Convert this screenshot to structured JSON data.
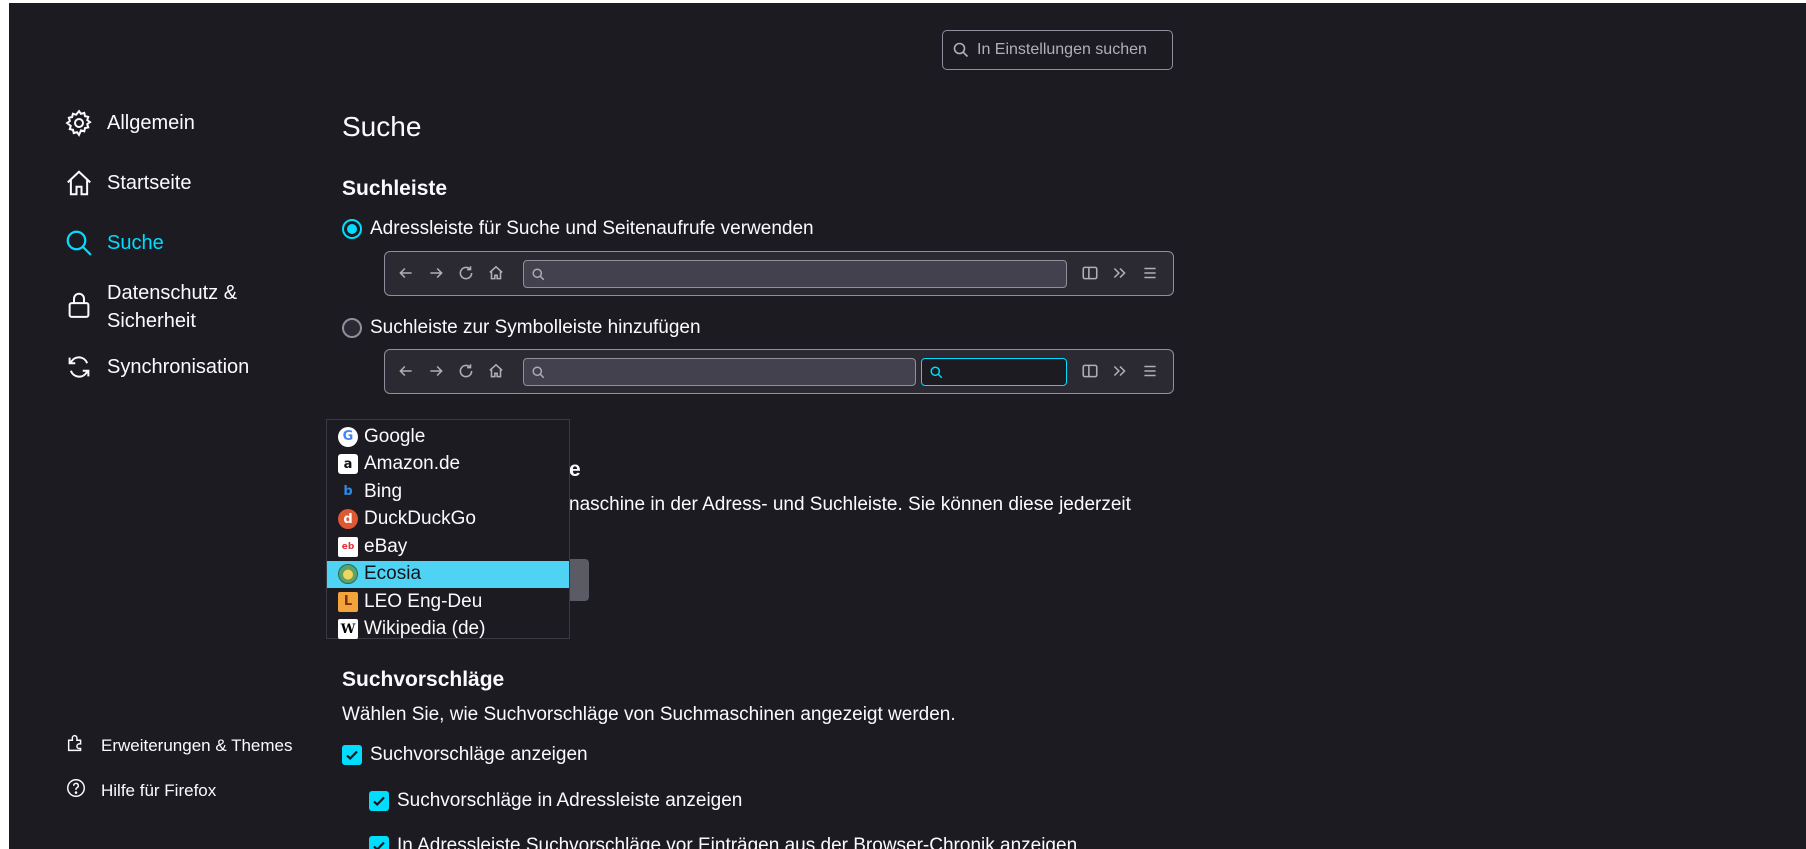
{
  "search": {
    "placeholder": "In Einstellungen suchen"
  },
  "sidebar": {
    "items": [
      {
        "label": "Allgemein",
        "icon": "gear-icon"
      },
      {
        "label": "Startseite",
        "icon": "home-icon"
      },
      {
        "label": "Suche",
        "icon": "search-icon",
        "active": true
      },
      {
        "label": "Datenschutz & Sicherheit",
        "icon": "lock-icon"
      },
      {
        "label": "Synchronisation",
        "icon": "sync-icon"
      }
    ],
    "bottom": [
      {
        "label": "Erweiterungen & Themes",
        "icon": "puzzle-icon"
      },
      {
        "label": "Hilfe für Firefox",
        "icon": "help-icon"
      }
    ]
  },
  "main": {
    "title": "Suche",
    "searchbar_section": {
      "title": "Suchleiste",
      "option1": "Adressleiste für Suche und Seitenaufrufe verwenden",
      "option2": "Suchleiste zur Symbolleiste hinzufügen"
    },
    "default_engine": {
      "title_tail": "e",
      "desc_tail": "naschine in der Adress- und Suchleiste. Sie können diese jederzeit"
    },
    "suggestions": {
      "title": "Suchvorschläge",
      "desc": "Wählen Sie, wie Suchvorschläge von Suchmaschinen angezeigt werden.",
      "check1": "Suchvorschläge anzeigen",
      "check2": "Suchvorschläge in Adressleiste anzeigen",
      "check3": "In Adressleiste Suchvorschläge vor Einträgen aus der Browser-Chronik anzeigen"
    }
  },
  "dropdown": {
    "items": [
      {
        "label": "Google",
        "icon": "google-icon"
      },
      {
        "label": "Amazon.de",
        "icon": "amazon-icon"
      },
      {
        "label": "Bing",
        "icon": "bing-icon"
      },
      {
        "label": "DuckDuckGo",
        "icon": "duckduckgo-icon"
      },
      {
        "label": "eBay",
        "icon": "ebay-icon"
      },
      {
        "label": "Ecosia",
        "icon": "ecosia-icon",
        "selected": true
      },
      {
        "label": "LEO Eng-Deu",
        "icon": "leo-icon"
      },
      {
        "label": "Wikipedia (de)",
        "icon": "wikipedia-icon"
      }
    ]
  },
  "colors": {
    "accent": "#00ddff",
    "background": "#1c1b22",
    "selected": "#4fd3f5"
  }
}
